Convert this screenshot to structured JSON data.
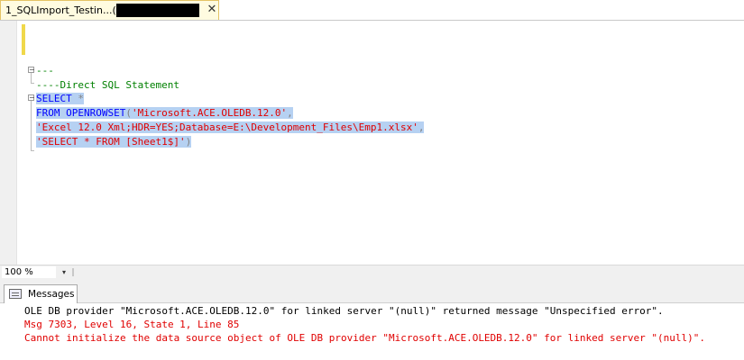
{
  "tab": {
    "title": "1_SQLImport_Testin...(",
    "close_label": "✕"
  },
  "editor": {
    "lines": [
      {
        "prefix": "--",
        "text": "---"
      },
      {
        "text": "----Direct SQL Statement"
      },
      {
        "text": "SELECT *"
      },
      {
        "text": "FROM OPENROWSET('Microsoft.ACE.OLEDB.12.0',"
      },
      {
        "text": "'Excel 12.0 Xml;HDR=YES;Database=E:\\Development_Files\\Emp1.xlsx',"
      },
      {
        "text": "'SELECT * FROM [Sheet1$]')"
      }
    ],
    "tokens": {
      "comment1": "---",
      "comment2": "----Direct SQL Statement",
      "select_kw": "SELECT",
      "select_star": " *",
      "from_kw": "FROM",
      "openrowset_kw": " OPENROWSET",
      "paren_open": "(",
      "provider_str": "'Microsoft.ACE.OLEDB.12.0'",
      "comma1": ",",
      "conn_str": "'Excel 12.0 Xml;HDR=YES;Database=E:\\Development_Files\\Emp1.xlsx'",
      "comma2": ",",
      "query_str": "'SELECT * FROM [Sheet1$]'",
      "paren_close": ")"
    }
  },
  "zoom": {
    "value": "100 %",
    "arrow": "▾"
  },
  "messages": {
    "tab_label": "Messages",
    "lines": [
      "OLE DB provider \"Microsoft.ACE.OLEDB.12.0\" for linked server \"(null)\" returned message \"Unspecified error\".",
      "Msg 7303, Level 16, State 1, Line 85",
      "Cannot initialize the data source object of OLE DB provider \"Microsoft.ACE.OLEDB.12.0\" for linked server \"(null)\"."
    ]
  },
  "colors": {
    "keyword": "#0000ff",
    "string": "#e00000",
    "comment": "#008000",
    "selection": "#b6d1f2",
    "error": "#e00000"
  }
}
